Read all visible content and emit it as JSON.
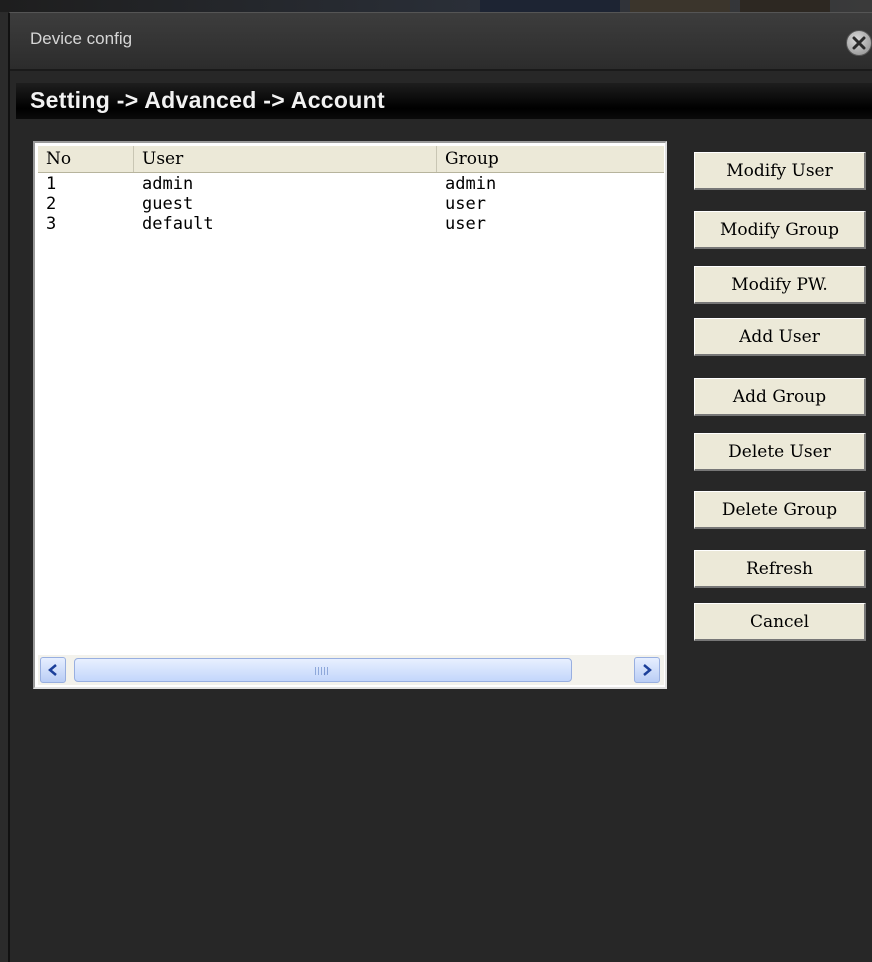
{
  "window": {
    "title": "Device config"
  },
  "breadcrumb": "Setting -> Advanced -> Account",
  "user_list": {
    "columns": [
      "No",
      "User",
      "Group"
    ],
    "rows": [
      {
        "no": "1",
        "user": "admin",
        "group": "admin"
      },
      {
        "no": "2",
        "user": "guest",
        "group": "user"
      },
      {
        "no": "3",
        "user": "default",
        "group": "user"
      }
    ]
  },
  "actions": [
    "Modify User",
    "Modify Group",
    "Modify PW.",
    "Add User",
    "Add Group",
    "Delete User",
    "Delete Group",
    "Refresh",
    "Cancel"
  ],
  "icons": {
    "close": "close-icon",
    "scroll_left": "chevron-left-icon",
    "scroll_right": "chevron-right-icon"
  },
  "colors": {
    "window_bg": "#272727",
    "breadcrumb_bar": "#000000",
    "button_face": "#ece9d8",
    "scrollbar_accent": "#c3d6fb"
  }
}
